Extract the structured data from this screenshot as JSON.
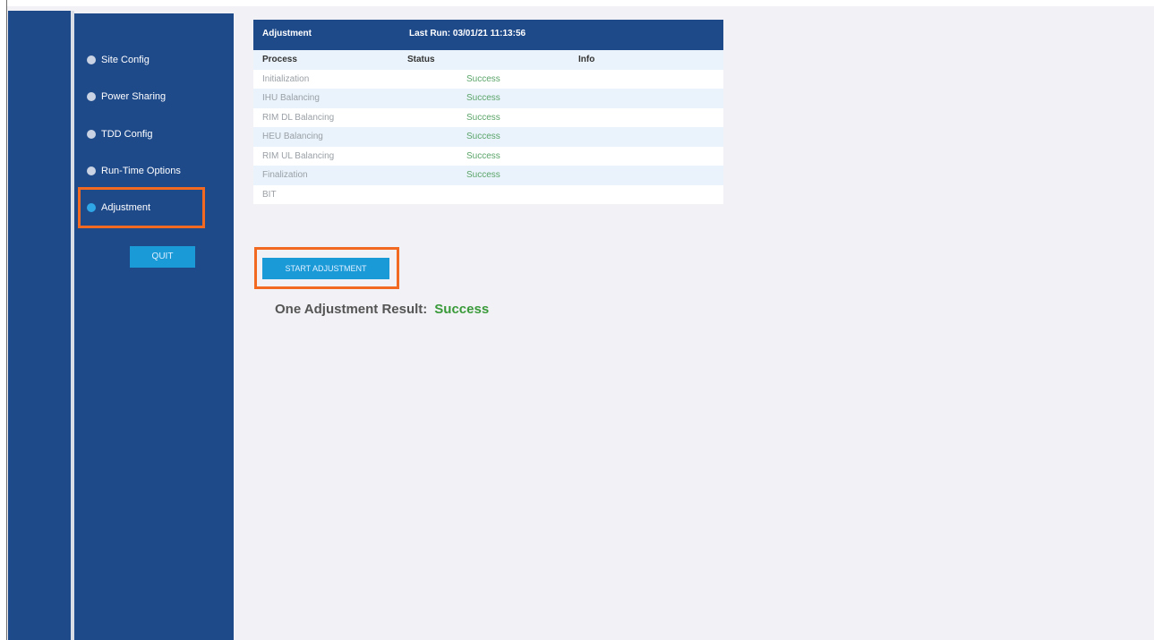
{
  "sidebar": {
    "items": [
      {
        "label": "Site Config",
        "active": false
      },
      {
        "label": "Power Sharing",
        "active": false
      },
      {
        "label": "TDD Config",
        "active": false
      },
      {
        "label": "Run-Time Options",
        "active": false
      },
      {
        "label": "Adjustment",
        "active": true
      }
    ],
    "quit_label": "QUIT"
  },
  "panel": {
    "title": "Adjustment",
    "last_run": "Last Run: 03/01/21 11:13:56",
    "columns": [
      "Process",
      "Status",
      "Info"
    ],
    "rows": [
      {
        "process": "Initialization",
        "status": "Success"
      },
      {
        "process": "IHU Balancing",
        "status": "Success"
      },
      {
        "process": "RIM DL Balancing",
        "status": "Success"
      },
      {
        "process": "HEU Balancing",
        "status": "Success"
      },
      {
        "process": "RIM UL Balancing",
        "status": "Success"
      },
      {
        "process": "Finalization",
        "status": "Success"
      },
      {
        "process": "BIT",
        "status": ""
      }
    ]
  },
  "actions": {
    "start_label": "START ADJUSTMENT"
  },
  "result": {
    "label": "One Adjustment Result:",
    "value": "Success"
  },
  "colors": {
    "sidebar": "#1f4a8a",
    "accent": "#1b9ad8",
    "highlight": "#f26a21",
    "success": "#3a9a3a"
  }
}
